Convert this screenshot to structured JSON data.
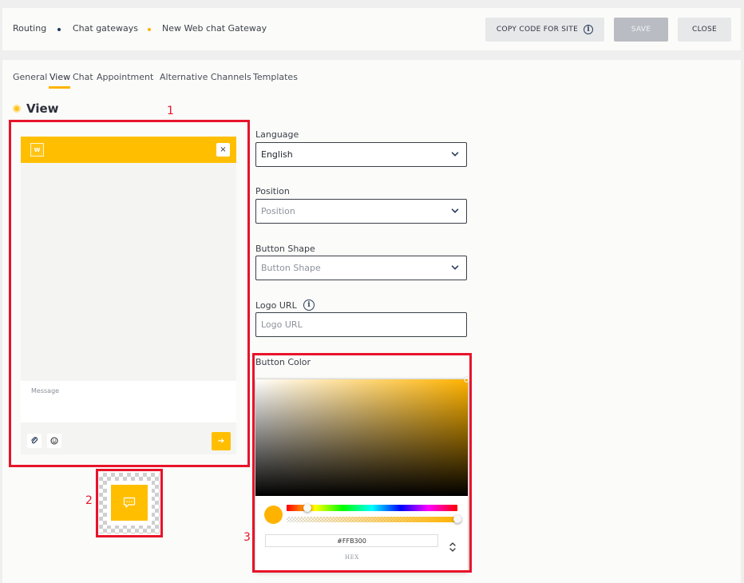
{
  "breadcrumb": {
    "items": [
      "Routing",
      "Chat gateways",
      "New Web chat Gateway"
    ],
    "dot_colors": [
      "#1f3a5f",
      "#ffb300"
    ]
  },
  "toolbar": {
    "copy_label": "COPY CODE FOR SITE",
    "save_label": "SAVE",
    "close_label": "CLOSE"
  },
  "tabs": [
    {
      "label": "General"
    },
    {
      "label": "View"
    },
    {
      "label": "Chat"
    },
    {
      "label": "Appointment"
    },
    {
      "label": "Alternative Channels"
    },
    {
      "label": "Templates"
    }
  ],
  "active_tab": "View",
  "section": {
    "title": "View"
  },
  "annotations": [
    "1",
    "2",
    "3"
  ],
  "preview": {
    "logo_letter": "W",
    "close_glyph": "×",
    "message_placeholder": "Message",
    "send_glyph": "➔"
  },
  "form": {
    "language": {
      "label": "Language",
      "value": "English"
    },
    "position": {
      "label": "Position",
      "placeholder": "Position"
    },
    "button_shape": {
      "label": "Button Shape",
      "placeholder": "Button Shape"
    },
    "logo_url": {
      "label": "Logo URL",
      "placeholder": "Logo URL"
    },
    "button_color": {
      "label": "Button Color"
    }
  },
  "color_picker": {
    "hex_value": "#FFB300",
    "mode_label": "HEX",
    "hue_fraction": 0.12,
    "alpha_fraction": 1.0
  },
  "colors": {
    "accent": "#ffb300",
    "header_yellow": "#ffbf00",
    "annotation_red": "#e8132a"
  },
  "icons": {
    "info": "info-icon",
    "chevron": "chevron-down-icon",
    "attach": "paperclip-icon",
    "emoji": "smiley-icon",
    "launcher": "chat-bubble-icon"
  }
}
